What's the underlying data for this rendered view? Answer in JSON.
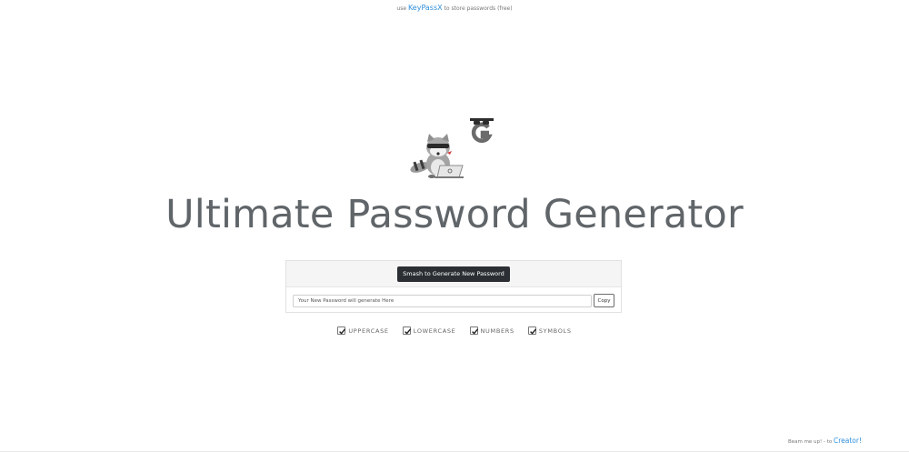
{
  "header_note": {
    "prefix": "use",
    "link_text": "KeyPassX",
    "suffix": "to store passwords (free)"
  },
  "hero": {
    "title": "Ultimate Password Generator"
  },
  "generator": {
    "generate_button_label": "Smash to Generate New Password",
    "password_placeholder": "Your New Password will generate Here",
    "copy_button_label": "Copy"
  },
  "options": [
    {
      "label": "UPPERCASE",
      "checked": true
    },
    {
      "label": "LOWERCASE",
      "checked": true
    },
    {
      "label": "NUMBERS",
      "checked": true
    },
    {
      "label": "SYMBOLS",
      "checked": true
    }
  ],
  "footer_note": {
    "prefix": "Beam me up! - to",
    "link_text": "Creator!"
  },
  "colors": {
    "accent": "#2f8fdc",
    "button_dark": "#2b2f33",
    "title": "#606569"
  }
}
